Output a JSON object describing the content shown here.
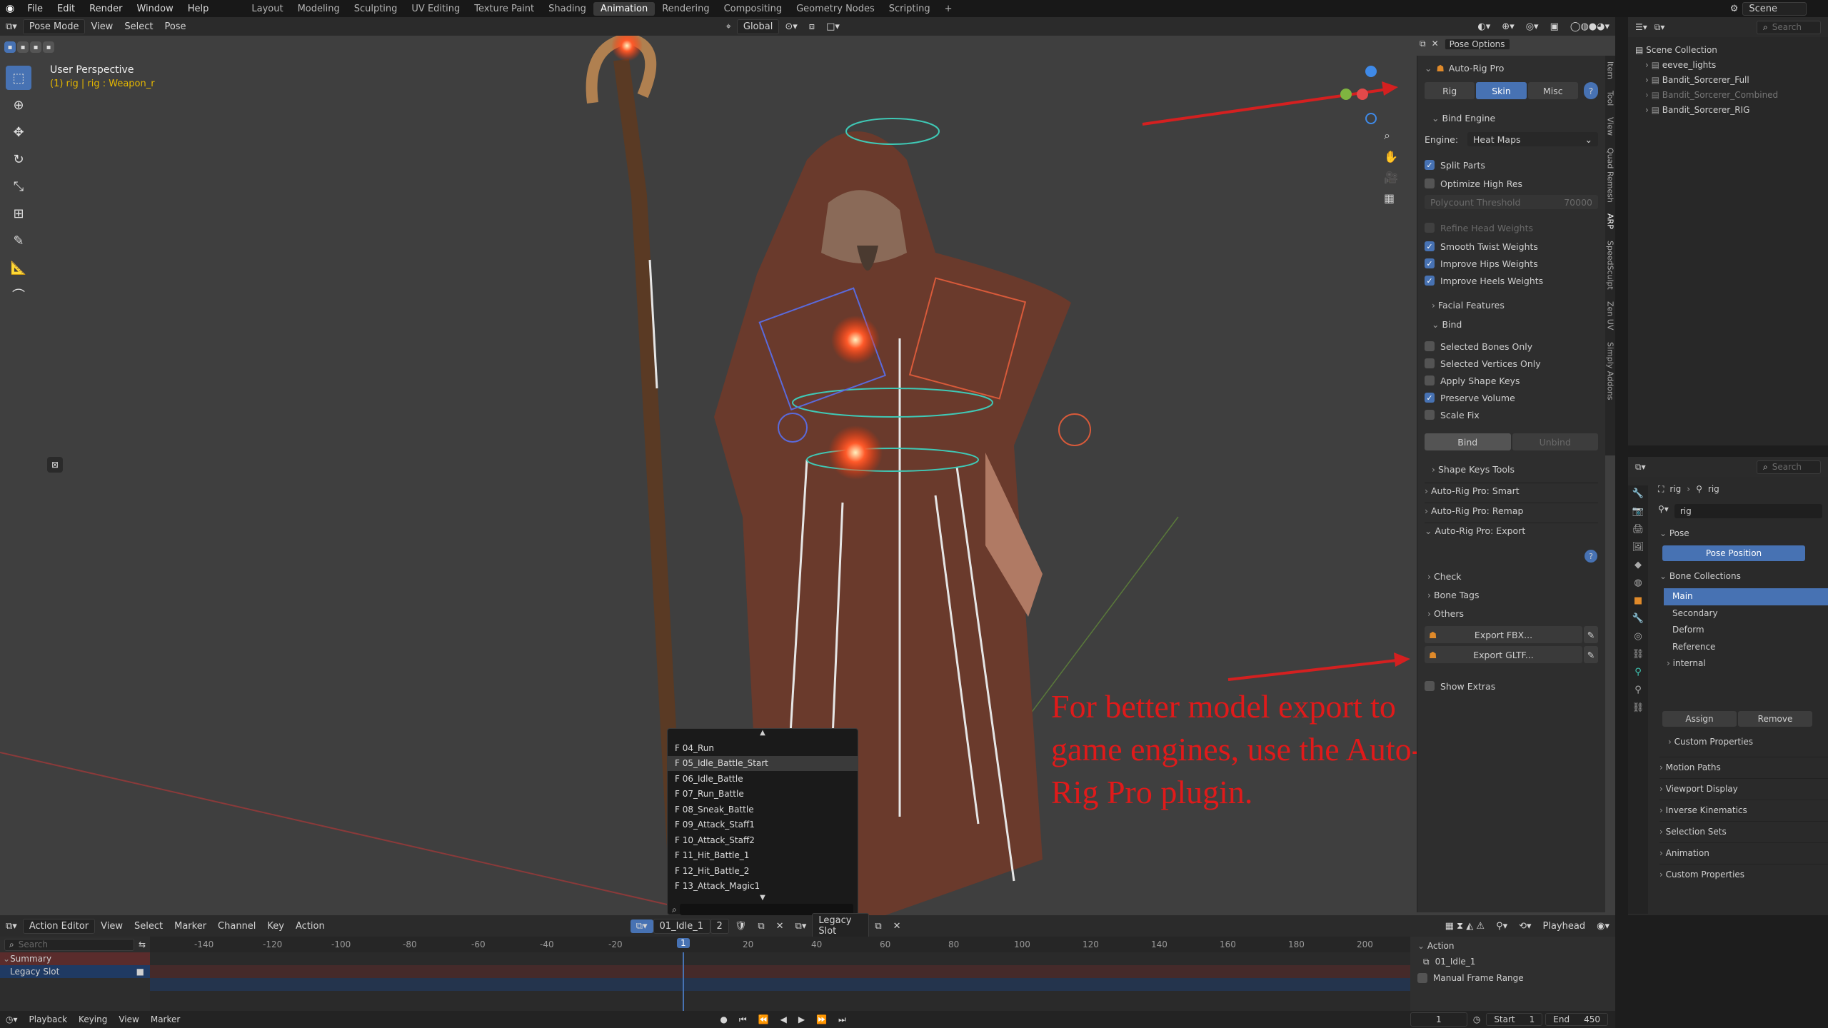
{
  "topbar": {
    "menus": [
      "File",
      "Edit",
      "Render",
      "Window",
      "Help"
    ],
    "workspaces": [
      "Layout",
      "Modeling",
      "Sculpting",
      "UV Editing",
      "Texture Paint",
      "Shading",
      "Animation",
      "Rendering",
      "Compositing",
      "Geometry Nodes",
      "Scripting"
    ],
    "active_workspace": "Animation",
    "add_tab": "+",
    "scene_label": "Scene"
  },
  "viewport_header": {
    "mode": "Pose Mode",
    "menus": [
      "View",
      "Select",
      "Pose"
    ],
    "orientation": "Global",
    "pose_options": "Pose Options"
  },
  "viewport": {
    "perspective": "User Perspective",
    "context": "(1) rig | rig : Weapon_r"
  },
  "annotation": {
    "text": "For better model export to game engines, use the Auto-Rig Pro plugin."
  },
  "npanel": {
    "title": "Auto-Rig Pro",
    "tabs": [
      "Rig",
      "Skin",
      "Misc"
    ],
    "active_tab": "Skin",
    "bind_engine_label": "Bind Engine",
    "engine_label": "Engine:",
    "engine_value": "Heat Maps",
    "split_parts": "Split Parts",
    "optimize_high_res": "Optimize High Res",
    "polycount_label": "Polycount Threshold",
    "polycount_value": "70000",
    "refine_head": "Refine Head Weights",
    "smooth_twist": "Smooth Twist Weights",
    "improve_hips": "Improve Hips Weights",
    "improve_heels": "Improve Heels Weights",
    "facial_features": "Facial Features",
    "bind_section": "Bind",
    "selected_bones": "Selected Bones Only",
    "selected_vertices": "Selected Vertices Only",
    "apply_shape_keys": "Apply Shape Keys",
    "preserve_volume": "Preserve Volume",
    "scale_fix": "Scale Fix",
    "bind_button": "Bind",
    "unbind_button": "Unbind",
    "shape_keys_tools": "Shape Keys Tools",
    "smart": "Auto-Rig Pro: Smart",
    "remap": "Auto-Rig Pro: Remap",
    "export": "Auto-Rig Pro: Export",
    "check": "Check",
    "bone_tags": "Bone Tags",
    "others": "Others",
    "export_fbx": "Export FBX...",
    "export_gltf": "Export GLTF...",
    "show_extras": "Show Extras"
  },
  "vertical_tabs": [
    "Item",
    "Tool",
    "View",
    "Quad Remesh",
    "ARP",
    "SpeedSculpt",
    "Zen UV",
    "Simply Addons"
  ],
  "outliner": {
    "search_placeholder": "Search",
    "root": "Scene Collection",
    "items": [
      "eevee_lights",
      "Bandit_Sorcerer_Full",
      "Bandit_Sorcerer_Combined",
      "Bandit_Sorcerer_RIG"
    ]
  },
  "properties": {
    "search_placeholder": "Search",
    "breadcrumb_a": "rig",
    "breadcrumb_b": "rig",
    "data_name": "rig",
    "pose_section": "Pose",
    "pose_position": "Pose Position",
    "bone_collections": "Bone Collections",
    "collections": [
      "Main",
      "Secondary",
      "Deform",
      "Reference",
      "internal"
    ],
    "assign": "Assign",
    "remove": "Remove",
    "custom_properties_inner": "Custom Properties",
    "sections": [
      "Motion Paths",
      "Viewport Display",
      "Inverse Kinematics",
      "Selection Sets",
      "Animation",
      "Custom Properties"
    ]
  },
  "dropdown": {
    "items": [
      "F 04_Run",
      "F 05_Idle_Battle_Start",
      "F 06_Idle_Battle",
      "F 07_Run_Battle",
      "F 08_Sneak_Battle",
      "F 09_Attack_Staff1",
      "F 10_Attack_Staff2",
      "F 11_Hit_Battle_1",
      "F 12_Hit_Battle_2",
      "F 13_Attack_Magic1"
    ],
    "highlighted": 1
  },
  "action_editor": {
    "mode": "Action Editor",
    "menus": [
      "View",
      "Select",
      "Marker",
      "Channel",
      "Key",
      "Action"
    ],
    "action_name": "01_Idle_1",
    "users": "2",
    "slot": "Legacy Slot",
    "playhead": "Playhead",
    "search_placeholder": "Search",
    "summary": "Summary",
    "legacy_slot": "Legacy Slot",
    "ruler": [
      "-140",
      "-120",
      "-100",
      "-80",
      "-60",
      "-40",
      "-20",
      "1",
      "20",
      "40",
      "60",
      "80",
      "100",
      "120",
      "140",
      "160",
      "180",
      "200"
    ],
    "current_frame": "1",
    "side_action": "Action",
    "side_action_name": "01_Idle_1",
    "manual_range": "Manual Frame Range"
  },
  "statusbar": {
    "menus": [
      "Playback",
      "Keying",
      "View",
      "Marker"
    ],
    "frame": "1",
    "start_label": "Start",
    "start_value": "1",
    "end_label": "End",
    "end_value": "450"
  }
}
